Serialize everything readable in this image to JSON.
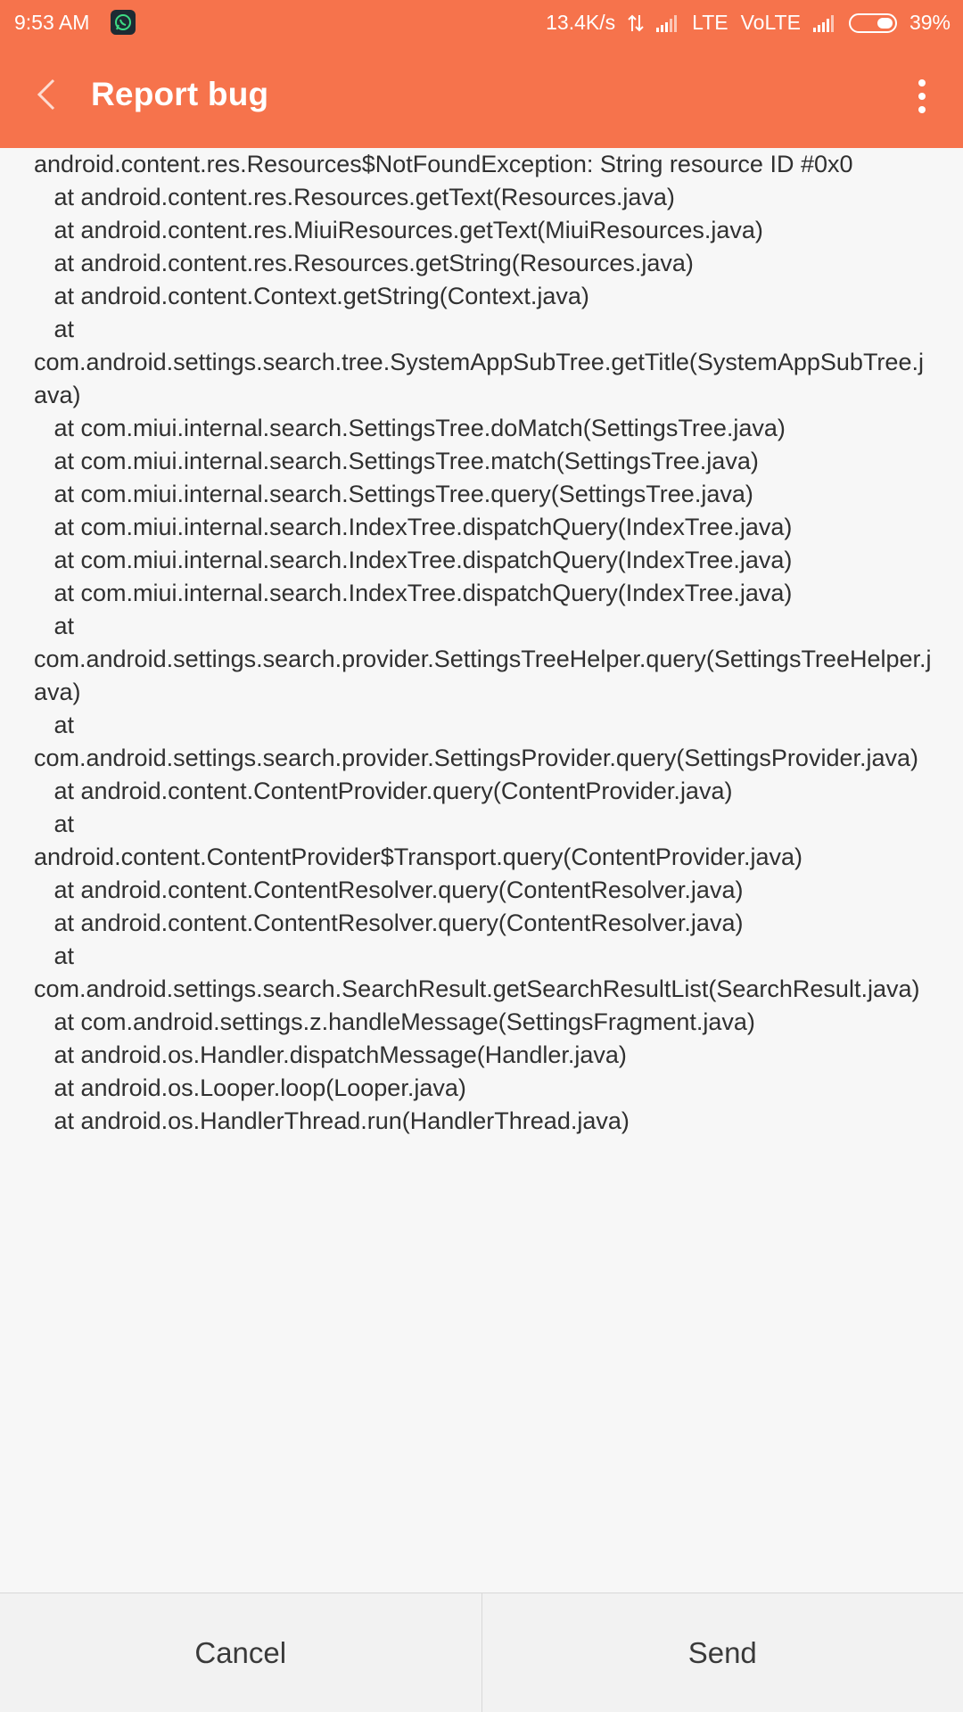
{
  "status_bar": {
    "time": "9:53 AM",
    "notification_icon": "whatsapp-icon",
    "net_speed": "13.4K/s",
    "lte_label": "LTE",
    "volte_label": "VoLTE",
    "battery_percent": "39%",
    "battery_level": 0.39
  },
  "app_bar": {
    "title": "Report bug",
    "back_icon": "chevron-left-icon",
    "menu_icon": "more-vertical-icon",
    "color": "#f6734c"
  },
  "log": {
    "text": "android.content.res.Resources$NotFoundException: String resource ID #0x0\n   at android.content.res.Resources.getText(Resources.java)\n   at android.content.res.MiuiResources.getText(MiuiResources.java)\n   at android.content.res.Resources.getString(Resources.java)\n   at android.content.Context.getString(Context.java)\n   at\ncom.android.settings.search.tree.SystemAppSubTree.getTitle(SystemAppSubTree.java)\n   at com.miui.internal.search.SettingsTree.doMatch(SettingsTree.java)\n   at com.miui.internal.search.SettingsTree.match(SettingsTree.java)\n   at com.miui.internal.search.SettingsTree.query(SettingsTree.java)\n   at com.miui.internal.search.IndexTree.dispatchQuery(IndexTree.java)\n   at com.miui.internal.search.IndexTree.dispatchQuery(IndexTree.java)\n   at com.miui.internal.search.IndexTree.dispatchQuery(IndexTree.java)\n   at\ncom.android.settings.search.provider.SettingsTreeHelper.query(SettingsTreeHelper.java)\n   at\ncom.android.settings.search.provider.SettingsProvider.query(SettingsProvider.java)\n   at android.content.ContentProvider.query(ContentProvider.java)\n   at\nandroid.content.ContentProvider$Transport.query(ContentProvider.java)\n   at android.content.ContentResolver.query(ContentResolver.java)\n   at android.content.ContentResolver.query(ContentResolver.java)\n   at\ncom.android.settings.search.SearchResult.getSearchResultList(SearchResult.java)\n   at com.android.settings.z.handleMessage(SettingsFragment.java)\n   at android.os.Handler.dispatchMessage(Handler.java)\n   at android.os.Looper.loop(Looper.java)\n   at android.os.HandlerThread.run(HandlerThread.java)"
  },
  "actions": {
    "cancel_label": "Cancel",
    "send_label": "Send"
  }
}
